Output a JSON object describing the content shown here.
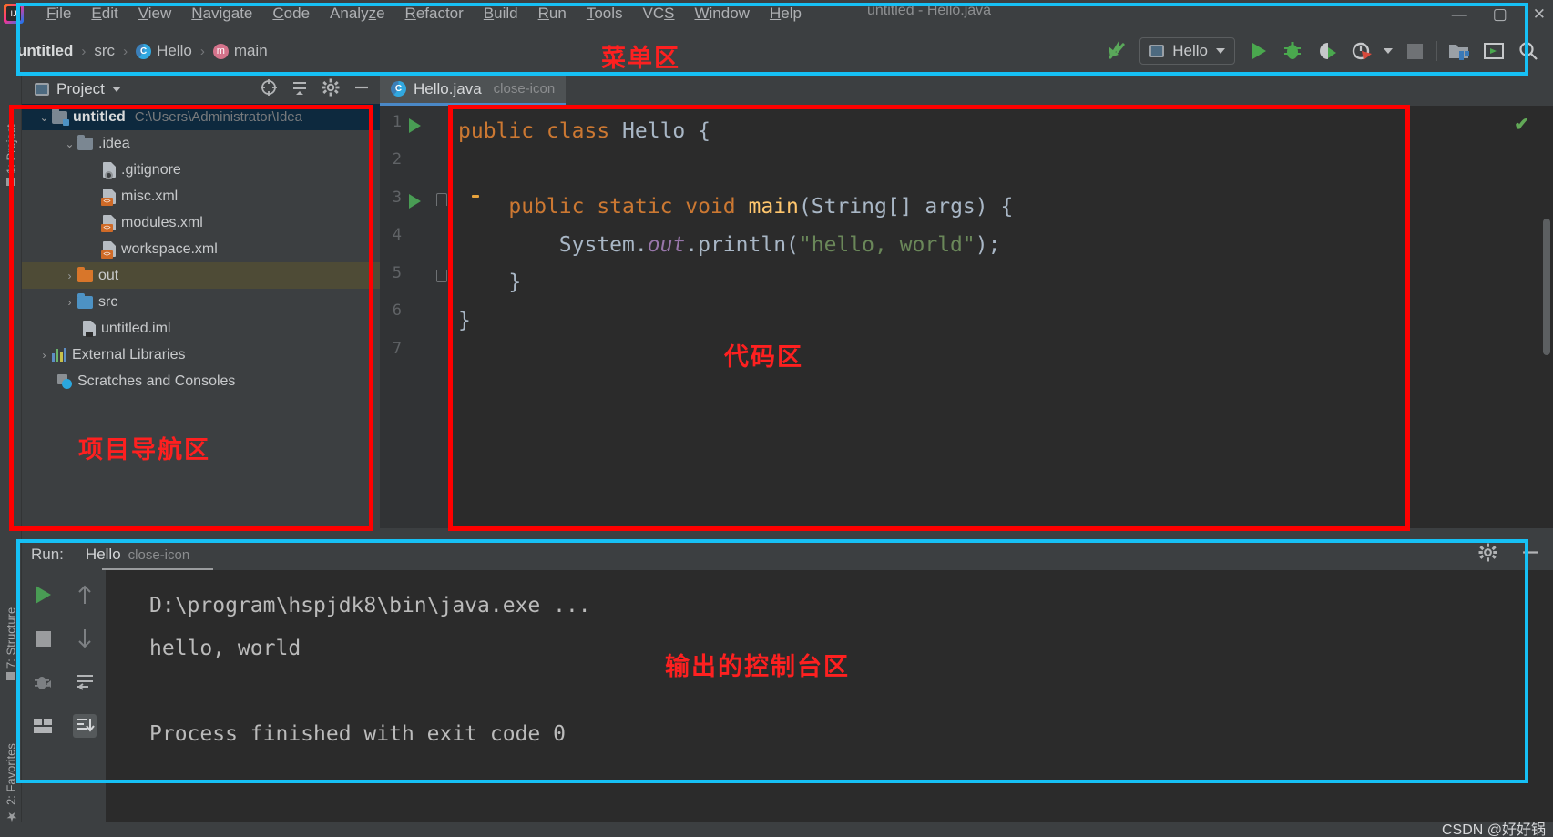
{
  "window": {
    "title": "untitled - Hello.java",
    "app_logo": "intellij-idea-logo",
    "minimize": "—",
    "maximize": "▢",
    "close": "✕"
  },
  "menu": {
    "items": [
      {
        "label": "File",
        "mnemonic": "F"
      },
      {
        "label": "Edit",
        "mnemonic": "E"
      },
      {
        "label": "View",
        "mnemonic": "V"
      },
      {
        "label": "Navigate",
        "mnemonic": "N"
      },
      {
        "label": "Code",
        "mnemonic": "C"
      },
      {
        "label": "Analyze",
        "mnemonic": "z"
      },
      {
        "label": "Refactor",
        "mnemonic": "R"
      },
      {
        "label": "Build",
        "mnemonic": "B"
      },
      {
        "label": "Run",
        "mnemonic": "R"
      },
      {
        "label": "Tools",
        "mnemonic": "T"
      },
      {
        "label": "VCS",
        "mnemonic": "S"
      },
      {
        "label": "Window",
        "mnemonic": "W"
      },
      {
        "label": "Help",
        "mnemonic": "H"
      }
    ]
  },
  "breadcrumbs": {
    "sep": "›",
    "items": [
      {
        "label": "untitled",
        "icon": "project-icon"
      },
      {
        "label": "src",
        "icon": "folder-icon"
      },
      {
        "label": "Hello",
        "icon": "java-class-icon"
      },
      {
        "label": "main",
        "icon": "java-method-icon"
      }
    ]
  },
  "toolbar": {
    "update_project_icon": "update-project-arrow-icon",
    "run_configuration": "Hello",
    "run_config_dropdown_icon": "chevron-down-icon",
    "run_icon": "run-play-icon",
    "debug_icon": "debug-bug-icon",
    "run_coverage_icon": "run-with-coverage-icon",
    "profiler_icon": "profiler-clock-icon",
    "profiler_dropdown_icon": "chevron-down-icon",
    "stop_icon": "stop-square-icon",
    "project_structure_icon": "project-structure-icon",
    "terminal_icon": "terminal-icon",
    "search_icon": "search-icon"
  },
  "left_strip": {
    "items": [
      {
        "label": "1: Project",
        "icon": "project-tool-icon"
      },
      {
        "label": "7: Structure",
        "icon": "structure-tool-icon"
      },
      {
        "label": "2: Favorites",
        "icon": "favorites-star-icon"
      }
    ]
  },
  "project_panel": {
    "title": "Project",
    "title_dropdown_icon": "chevron-down-icon",
    "icons": [
      {
        "name": "locate-target-icon"
      },
      {
        "name": "collapse-all-icon"
      },
      {
        "name": "settings-gear-icon"
      },
      {
        "name": "hide-minimize-icon"
      }
    ],
    "tree": [
      {
        "label": "untitled",
        "path": "C:\\Users\\Administrator\\Idea",
        "indent": 0,
        "arrow": "⌄",
        "icon": "module-folder-icon",
        "bold": true,
        "state": "selected"
      },
      {
        "label": ".idea",
        "path": "",
        "indent": 1,
        "arrow": "⌄",
        "icon": "folder-icon",
        "bold": false,
        "state": ""
      },
      {
        "label": ".gitignore",
        "path": "",
        "indent": 2,
        "arrow": "",
        "icon": "gitignore-file-icon",
        "bold": false,
        "state": ""
      },
      {
        "label": "misc.xml",
        "path": "",
        "indent": 2,
        "arrow": "",
        "icon": "xml-file-icon",
        "bold": false,
        "state": ""
      },
      {
        "label": "modules.xml",
        "path": "",
        "indent": 2,
        "arrow": "",
        "icon": "xml-file-icon",
        "bold": false,
        "state": ""
      },
      {
        "label": "workspace.xml",
        "path": "",
        "indent": 2,
        "arrow": "",
        "icon": "xml-file-icon",
        "bold": false,
        "state": ""
      },
      {
        "label": "out",
        "path": "",
        "indent": 1,
        "arrow": "›",
        "icon": "output-folder-icon",
        "bold": false,
        "state": "highlighted"
      },
      {
        "label": "src",
        "path": "",
        "indent": 1,
        "arrow": "›",
        "icon": "source-folder-icon",
        "bold": false,
        "state": ""
      },
      {
        "label": "untitled.iml",
        "path": "",
        "indent": 2,
        "arrow": "",
        "icon": "iml-file-icon",
        "bold": false,
        "state": ""
      },
      {
        "label": "External Libraries",
        "path": "",
        "indent": 0,
        "arrow": "›",
        "icon": "libraries-icon",
        "bold": false,
        "state": ""
      },
      {
        "label": "Scratches and Consoles",
        "path": "",
        "indent": 0,
        "arrow": "",
        "icon": "scratches-icon",
        "bold": false,
        "state": ""
      }
    ]
  },
  "editor": {
    "tab": {
      "label": "Hello.java",
      "icon": "java-class-icon",
      "close_icon": "close-icon"
    },
    "inspection_status_icon": "inspections-ok-check-icon",
    "lines": [
      {
        "num": "1",
        "gutter": [
          "run-play-icon"
        ],
        "tokens": [
          {
            "t": "public ",
            "c": "kw"
          },
          {
            "t": "class ",
            "c": "kw"
          },
          {
            "t": "Hello ",
            "c": "cls"
          },
          {
            "t": "{",
            "c": "pn"
          }
        ]
      },
      {
        "num": "2",
        "gutter": [],
        "tokens": []
      },
      {
        "num": "3",
        "gutter": [
          "run-play-icon",
          "fold-collapse-icon",
          "intention-bulb-icon"
        ],
        "tokens": [
          {
            "t": "    ",
            "c": "pn"
          },
          {
            "t": "public ",
            "c": "kw"
          },
          {
            "t": "static ",
            "c": "kw"
          },
          {
            "t": "void ",
            "c": "kw"
          },
          {
            "t": "main",
            "c": "mth"
          },
          {
            "t": "(String[] args) {",
            "c": "pn"
          }
        ]
      },
      {
        "num": "4",
        "gutter": [],
        "tokens": [
          {
            "t": "        System.",
            "c": "pn"
          },
          {
            "t": "out",
            "c": "fld"
          },
          {
            "t": ".println(",
            "c": "pn"
          },
          {
            "t": "\"hello, world\"",
            "c": "str"
          },
          {
            "t": ");",
            "c": "pn"
          }
        ]
      },
      {
        "num": "5",
        "gutter": [
          "fold-end-icon"
        ],
        "tokens": [
          {
            "t": "    }",
            "c": "pn"
          }
        ]
      },
      {
        "num": "6",
        "gutter": [],
        "tokens": [
          {
            "t": "}",
            "c": "pn"
          }
        ]
      },
      {
        "num": "7",
        "gutter": [],
        "tokens": []
      }
    ]
  },
  "run_panel": {
    "label": "Run:",
    "tab": {
      "label": "Hello",
      "icon": "run-config-icon",
      "close_icon": "close-icon"
    },
    "settings_icon": "settings-gear-icon",
    "hide_icon": "hide-minimize-icon",
    "tools_left": [
      {
        "name": "rerun-play-icon"
      },
      {
        "name": "stop-square-icon"
      },
      {
        "name": "debug-dimmed-icon"
      },
      {
        "name": "layout-grid-icon"
      }
    ],
    "tools_right": [
      {
        "name": "arrow-up-icon"
      },
      {
        "name": "arrow-down-icon"
      },
      {
        "name": "soft-wrap-icon"
      },
      {
        "name": "scroll-to-end-icon"
      }
    ],
    "console_lines": [
      {
        "text": "D:\\program\\hspjdk8\\bin\\java.exe ...",
        "kind": "command"
      },
      {
        "text": "hello, world",
        "kind": "output"
      },
      {
        "text": "",
        "kind": "blank"
      },
      {
        "text": "Process finished with exit code 0",
        "kind": "output"
      }
    ]
  },
  "annotations": {
    "menu_area": "菜单区",
    "code_area": "代码区",
    "project_nav_area": "项目导航区",
    "console_area": "输出的控制台区",
    "red_color": "#fe0000",
    "cyan_color": "#16c0f5"
  },
  "watermark": "CSDN @好好锅"
}
